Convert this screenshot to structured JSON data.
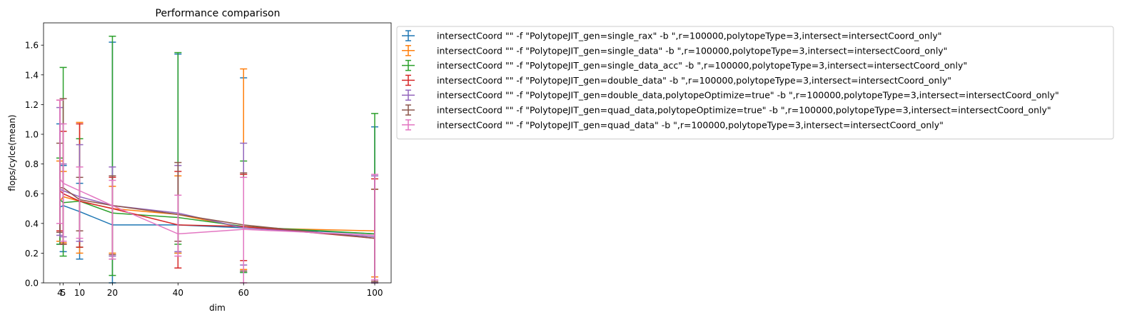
{
  "chart_data": {
    "type": "line",
    "title": "Performance comparison",
    "xlabel": "dim",
    "ylabel": "flops/cylce(mean)",
    "xlim": [
      -1,
      105
    ],
    "ylim": [
      0.0,
      1.75
    ],
    "x": [
      4,
      5,
      10,
      20,
      40,
      60,
      100
    ],
    "xticks": [
      4,
      5,
      10,
      20,
      40,
      60,
      100
    ],
    "yticks": [
      0.0,
      0.2,
      0.4,
      0.6,
      0.8,
      1.0,
      1.2,
      1.4,
      1.6
    ],
    "legend_position": "outside-upper-right",
    "grid": false,
    "series": [
      {
        "name": "intersectCoord \"\" -f \"PolytopeJIT_gen=single_rax\" -b \",r=100000,polytopeType=3,intersect=intersectCoord_only\"",
        "color": "#1f77b4",
        "values": [
          0.51,
          0.52,
          0.48,
          0.39,
          0.39,
          0.37,
          0.33
        ],
        "err_low": [
          0.26,
          0.21,
          0.16,
          0.0,
          0.2,
          0.07,
          0.0
        ],
        "err_high": [
          1.07,
          0.79,
          0.67,
          1.62,
          1.54,
          1.38,
          1.05
        ]
      },
      {
        "name": "intersectCoord \"\" -f \"PolytopeJIT_gen=single_data\" -b \",r=100000,polytopeType=3,intersect=intersectCoord_only\"",
        "color": "#ff7f0e",
        "values": [
          0.55,
          0.58,
          0.55,
          0.5,
          0.46,
          0.37,
          0.35
        ],
        "err_low": [
          0.28,
          0.27,
          0.2,
          0.2,
          0.2,
          0.09,
          0.04
        ],
        "err_high": [
          0.82,
          0.75,
          1.08,
          0.65,
          0.72,
          1.44,
          0.63
        ]
      },
      {
        "name": "intersectCoord \"\" -f \"PolytopeJIT_gen=single_data_acc\" -b \",r=100000,polytopeType=3,intersect=intersectCoord_only\"",
        "color": "#2ca02c",
        "values": [
          0.56,
          0.54,
          0.55,
          0.47,
          0.44,
          0.38,
          0.33
        ],
        "err_low": [
          0.26,
          0.18,
          0.24,
          0.05,
          0.26,
          0.07,
          0.0
        ],
        "err_high": [
          0.84,
          1.45,
          0.97,
          1.66,
          1.55,
          0.82,
          1.14
        ]
      },
      {
        "name": "intersectCoord \"\" -f \"PolytopeJIT_gen=double_data\" -b \",r=100000,polytopeType=3,intersect=intersectCoord_only\"",
        "color": "#d62728",
        "values": [
          0.62,
          0.6,
          0.55,
          0.5,
          0.39,
          0.38,
          0.3
        ],
        "err_low": [
          0.35,
          0.26,
          0.24,
          0.16,
          0.1,
          0.15,
          0.0
        ],
        "err_high": [
          1.23,
          1.02,
          1.07,
          0.71,
          0.75,
          0.73,
          0.7
        ]
      },
      {
        "name": "intersectCoord \"\" -f \"PolytopeJIT_gen=double_data,polytopeOptimize=true\" -b \",r=100000,polytopeType=3,intersect=intersectCoord_only\"",
        "color": "#9467bd",
        "values": [
          0.63,
          0.62,
          0.58,
          0.52,
          0.47,
          0.37,
          0.31
        ],
        "err_low": [
          0.32,
          0.31,
          0.28,
          0.18,
          0.21,
          0.12,
          0.0
        ],
        "err_high": [
          1.18,
          0.8,
          0.93,
          0.78,
          0.79,
          0.94,
          0.72
        ]
      },
      {
        "name": "intersectCoord \"\" -f \"PolytopeJIT_gen=quad_data,polytopeOptimize=true\" -b \",r=100000,polytopeType=3,intersect=intersectCoord_only\"",
        "color": "#8c564b",
        "values": [
          0.64,
          0.64,
          0.56,
          0.52,
          0.46,
          0.39,
          0.3
        ],
        "err_low": [
          0.34,
          0.26,
          0.35,
          0.19,
          0.28,
          0.08,
          0.01
        ],
        "err_high": [
          0.94,
          1.24,
          0.71,
          0.72,
          0.81,
          0.74,
          0.63
        ]
      },
      {
        "name": "intersectCoord \"\" -f \"PolytopeJIT_gen=quad_data\" -b \",r=100000,polytopeType=3,intersect=intersectCoord_only\"",
        "color": "#e377c2",
        "values": [
          0.7,
          0.67,
          0.62,
          0.52,
          0.33,
          0.36,
          0.32
        ],
        "err_low": [
          0.4,
          0.28,
          0.3,
          0.16,
          0.18,
          0.0,
          0.02
        ],
        "err_high": [
          1.23,
          1.07,
          0.78,
          0.69,
          0.59,
          0.71,
          0.73
        ]
      }
    ]
  }
}
